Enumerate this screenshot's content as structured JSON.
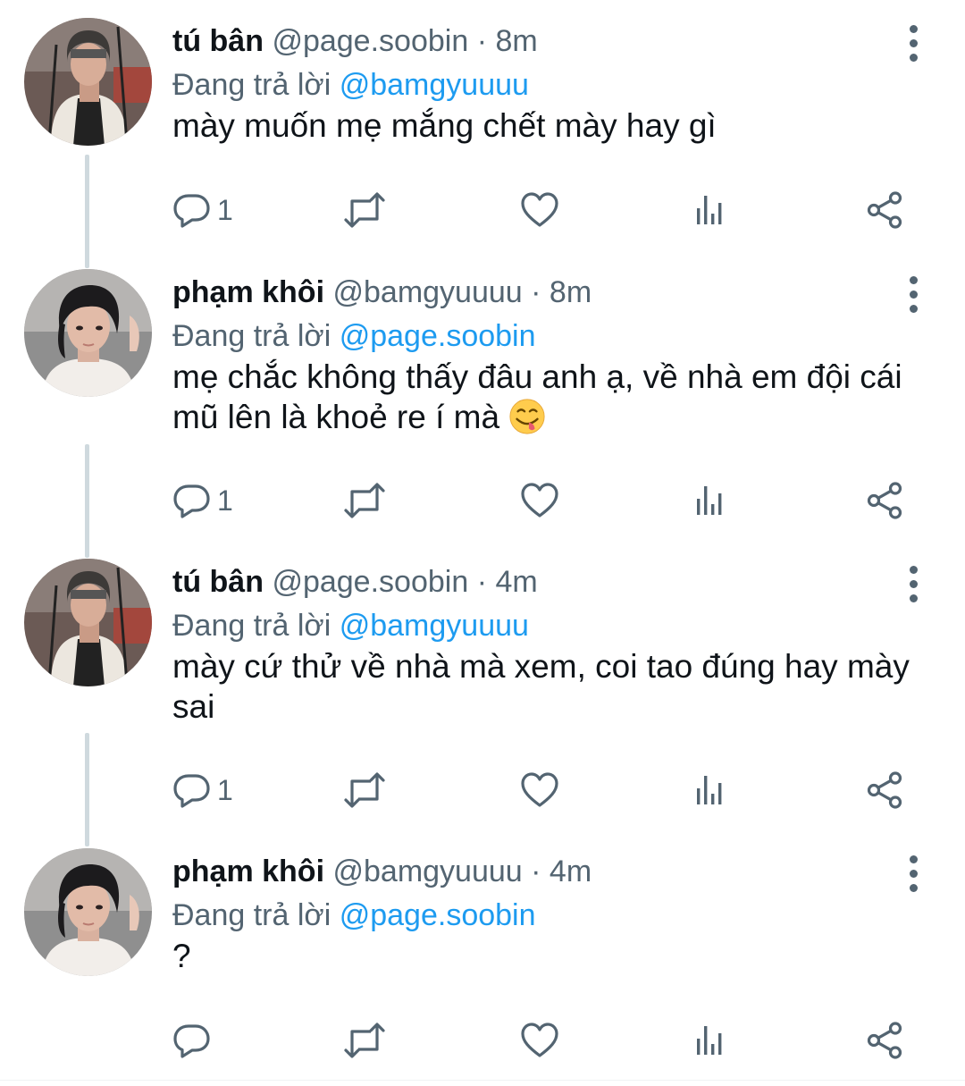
{
  "tweets": [
    {
      "display_name": "tú bân",
      "handle": "@page.soobin",
      "separator": "·",
      "time": "8m",
      "reply_prefix": "Đang trả lời",
      "reply_to": "@bamgyuuuu",
      "text": "mày muốn mẹ mắng chết mày hay gì",
      "reply_count": "1"
    },
    {
      "display_name": "phạm khôi",
      "handle": "@bamgyuuuu",
      "separator": "·",
      "time": "8m",
      "reply_prefix": "Đang trả lời",
      "reply_to": "@page.soobin",
      "text": "mẹ chắc không thấy đâu anh ạ, về nhà em đội cái mũ lên là khoẻ re í mà",
      "emoji": "face-savoring-food-emoji",
      "reply_count": "1"
    },
    {
      "display_name": "tú bân",
      "handle": "@page.soobin",
      "separator": "·",
      "time": "4m",
      "reply_prefix": "Đang trả lời",
      "reply_to": "@bamgyuuuu",
      "text": "mày cứ thử về nhà mà xem, coi tao đúng hay mày sai",
      "reply_count": "1"
    },
    {
      "display_name": "phạm khôi",
      "handle": "@bamgyuuuu",
      "separator": "·",
      "time": "4m",
      "reply_prefix": "Đang trả lời",
      "reply_to": "@page.soobin",
      "text": "?",
      "reply_count": ""
    }
  ],
  "icons": {
    "more": "more-vertical-icon",
    "reply": "reply-bubble-icon",
    "retweet": "retweet-icon",
    "like": "heart-icon",
    "views": "views-bars-icon",
    "share": "share-icon"
  },
  "colors": {
    "text": "#0f1419",
    "muted": "#536471",
    "link": "#1d9bf0",
    "thread_line": "#cfd9de"
  }
}
